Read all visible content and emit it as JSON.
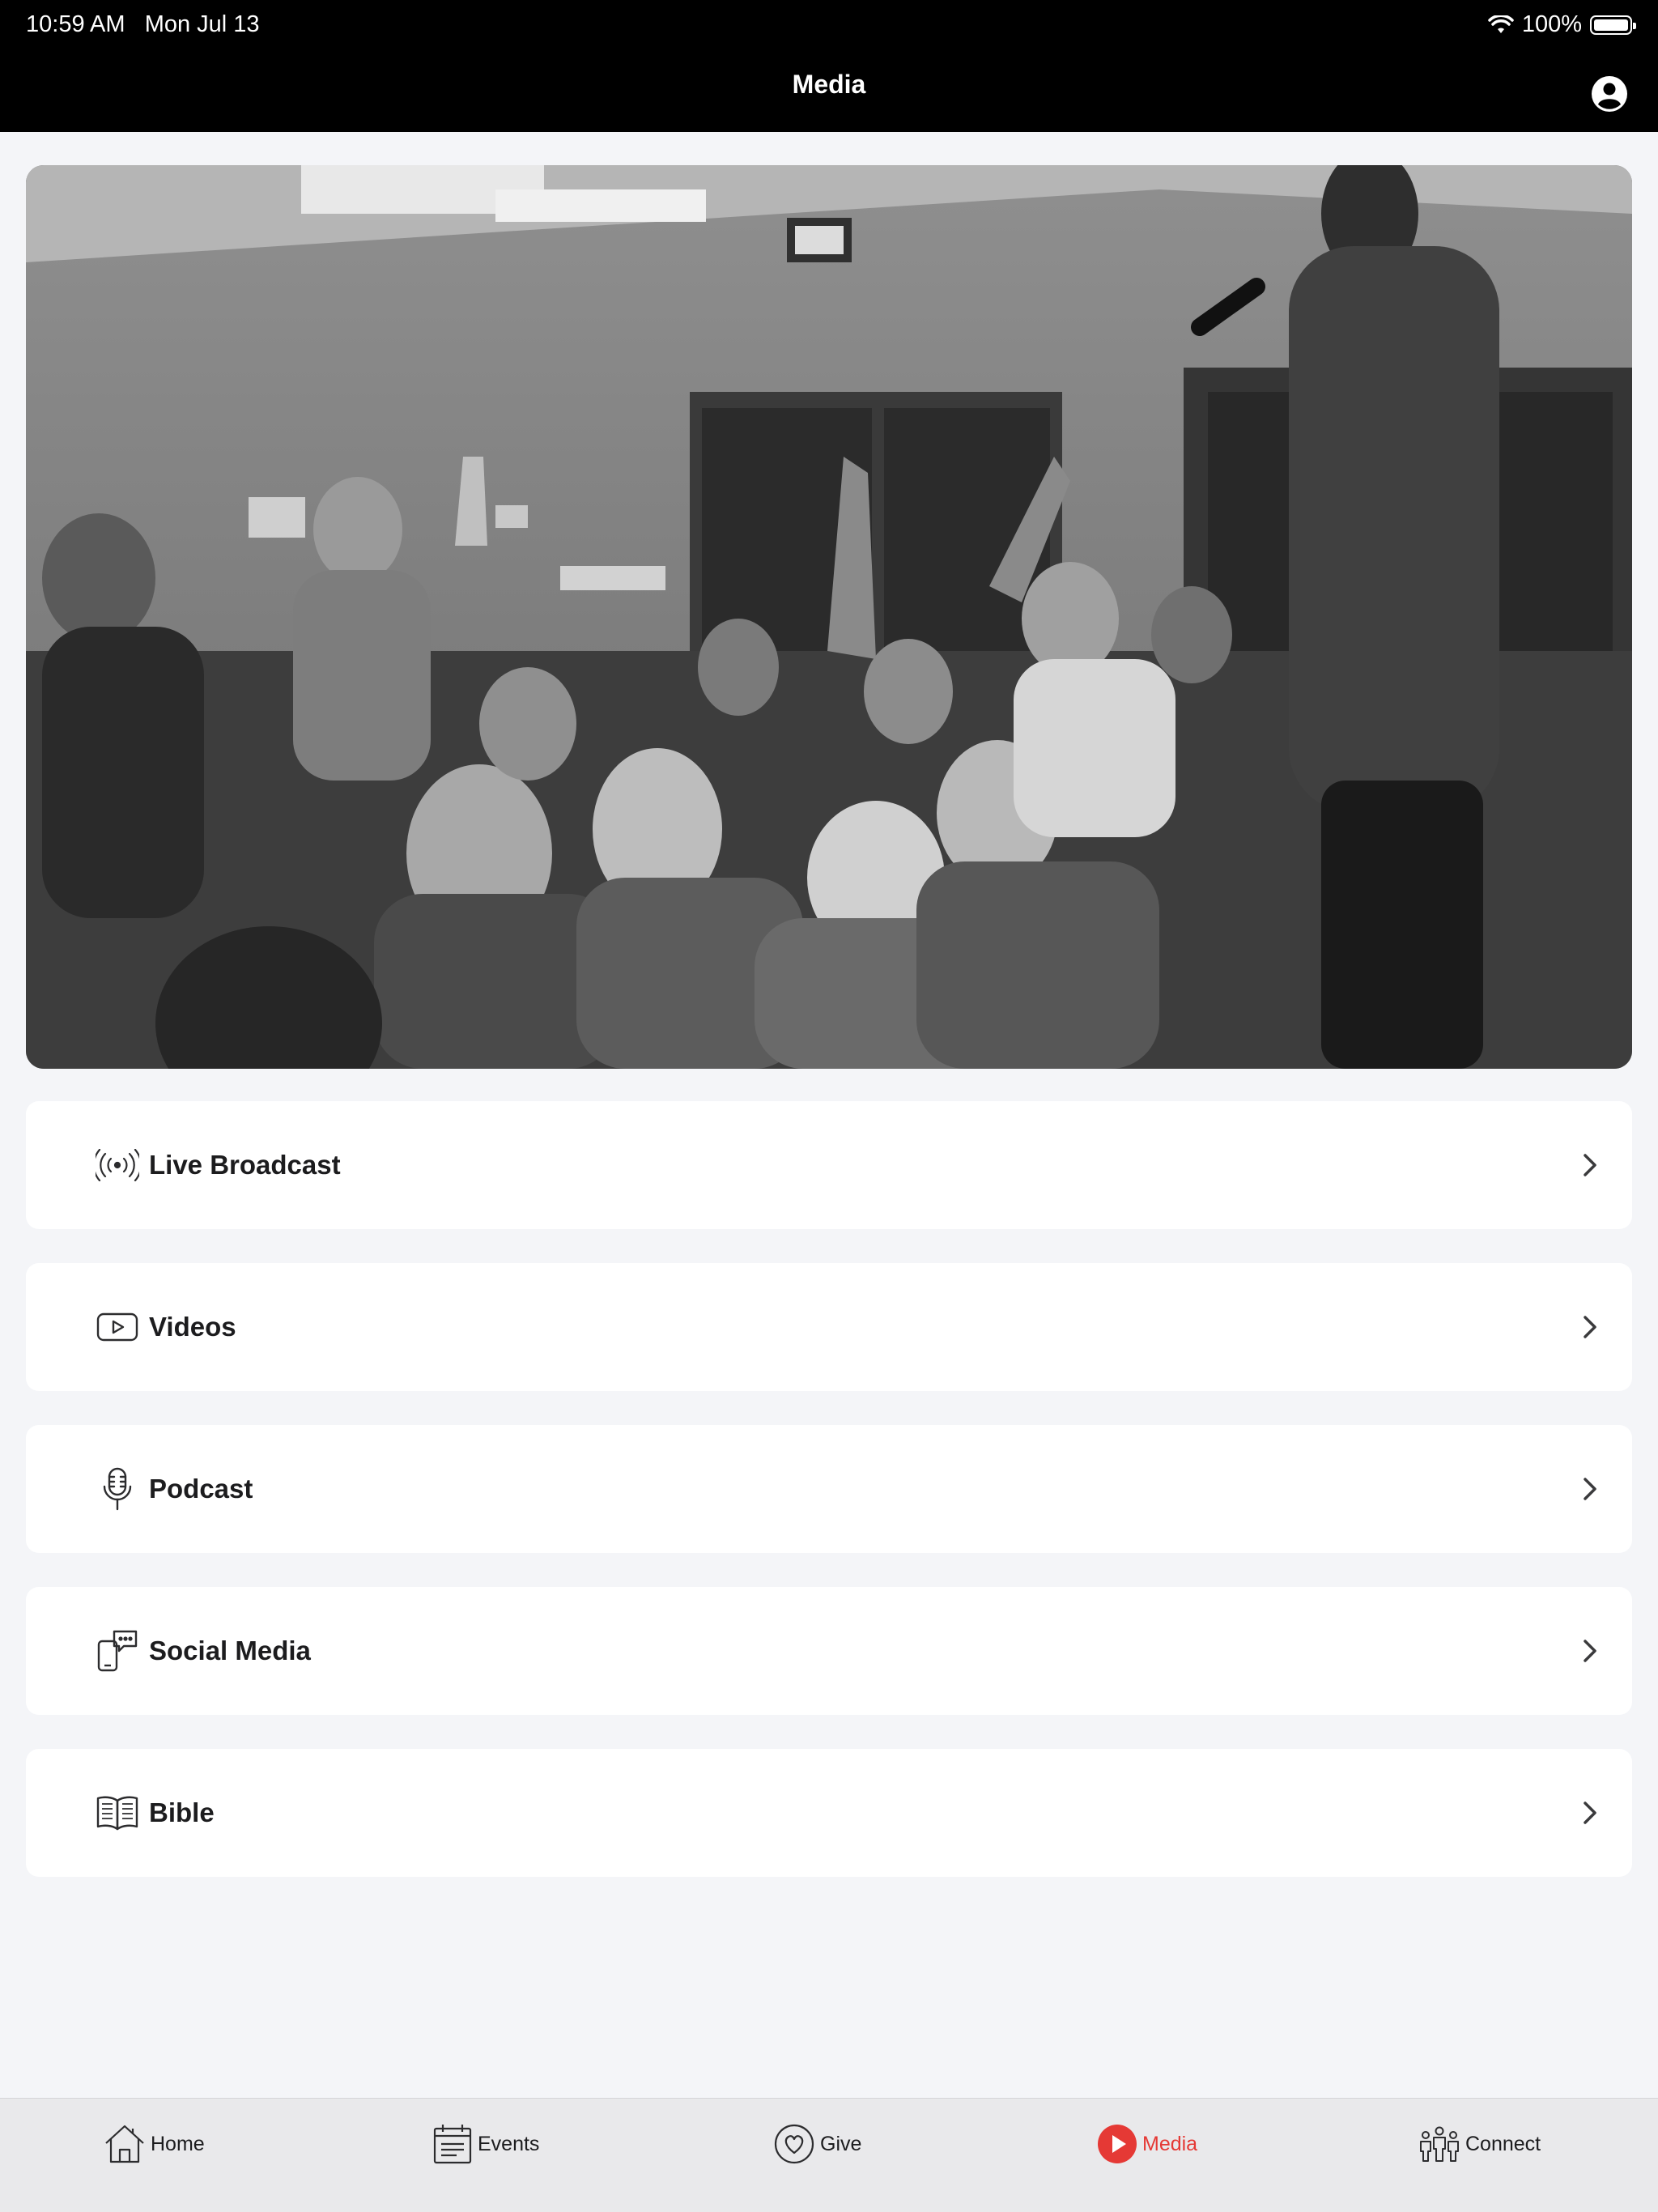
{
  "status": {
    "time": "10:59 AM",
    "date": "Mon Jul 13",
    "battery": "100%",
    "battery_level": 1.0
  },
  "header": {
    "title": "Media"
  },
  "menu": [
    {
      "label": "Live Broadcast",
      "icon": "broadcast-icon"
    },
    {
      "label": "Videos",
      "icon": "video-play-icon"
    },
    {
      "label": "Podcast",
      "icon": "microphone-icon"
    },
    {
      "label": "Social Media",
      "icon": "phone-chat-icon"
    },
    {
      "label": "Bible",
      "icon": "open-book-icon"
    }
  ],
  "tabs": [
    {
      "label": "Home",
      "icon": "home-icon",
      "active": false
    },
    {
      "label": "Events",
      "icon": "calendar-icon",
      "active": false
    },
    {
      "label": "Give",
      "icon": "heart-circle-icon",
      "active": false
    },
    {
      "label": "Media",
      "icon": "play-circle-icon",
      "active": true
    },
    {
      "label": "Connect",
      "icon": "people-icon",
      "active": false
    }
  ],
  "colors": {
    "accent": "#e53935",
    "header_bg": "#000000",
    "page_bg": "#f4f5f8",
    "tabbar_bg": "#e9e9eb"
  }
}
